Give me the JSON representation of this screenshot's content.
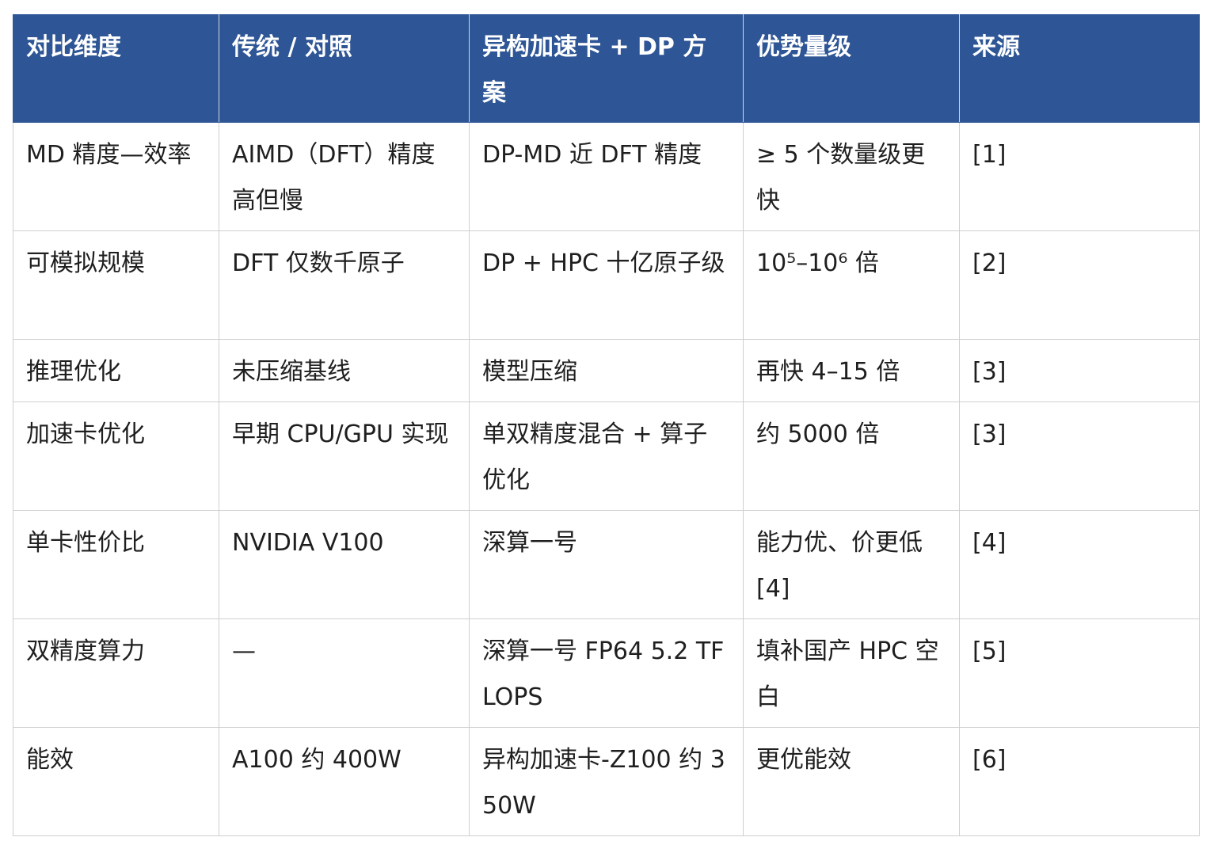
{
  "table": {
    "headers": [
      "对比维度",
      "传统 / 对照",
      "异构加速卡 + DP 方案",
      "优势量级",
      "来源"
    ],
    "rows": [
      [
        "MD 精度—效率",
        "AIMD（DFT）精度高但慢",
        "DP-MD 近 DFT 精度",
        "≥ 5 个数量级更快",
        "[1]"
      ],
      [
        "可模拟规模",
        "DFT 仅数千原子",
        "DP + HPC 十亿原子级",
        "10⁵–10⁶ 倍",
        "[2]"
      ],
      [
        "推理优化",
        "未压缩基线",
        "模型压缩",
        "再快 4–15 倍",
        "[3]"
      ],
      [
        "加速卡优化",
        "早期 CPU/GPU 实现",
        "单双精度混合 + 算子优化",
        "约 5000 倍",
        "[3]"
      ],
      [
        "单卡性价比",
        "NVIDIA V100",
        "深算一号",
        "能力优、价更低 [4]",
        "[4]"
      ],
      [
        "双精度算力",
        "—",
        "深算一号 FP64 5.2 TFLOPS",
        "填补国产 HPC 空白",
        "[5]"
      ],
      [
        "能效",
        "A100 约 400W",
        "异构加速卡-Z100 约 350W",
        "更优能效",
        "[6]"
      ]
    ]
  },
  "colors": {
    "header_bg": "#2e5595",
    "header_text": "#ffffff",
    "border": "#cfcfcf",
    "body_text": "#1f1f1f"
  }
}
